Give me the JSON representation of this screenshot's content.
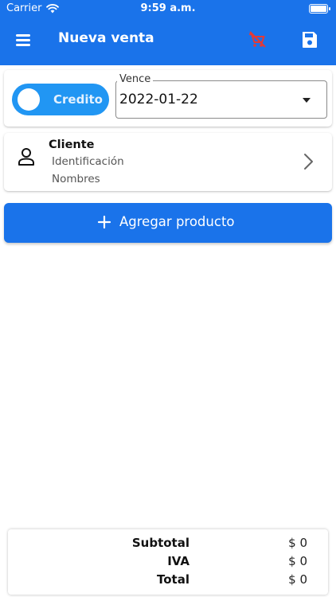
{
  "status_bar": {
    "carrier": "Carrier",
    "time": "9:59 a.m."
  },
  "app_bar": {
    "title": "Nueva venta",
    "icons": [
      "menu-icon",
      "remove-shopping-cart-icon",
      "save-icon"
    ],
    "cart_icon_color": "#e53935"
  },
  "sale": {
    "payment_toggle_label": "Credito",
    "due_label": "Vence",
    "due_date": "2022-01-22"
  },
  "client": {
    "title": "Cliente",
    "identification_label": "Identificación",
    "names_label": "Nombres"
  },
  "add_product": {
    "label": "Agregar producto"
  },
  "totals": {
    "subtotal_label": "Subtotal",
    "subtotal_value": "$ 0",
    "iva_label": "IVA",
    "iva_value": "$ 0",
    "total_label": "Total",
    "total_value": "$ 0"
  },
  "colors": {
    "primary": "#1a73ea",
    "toggle": "#2196f3",
    "background": "#ffffff"
  }
}
